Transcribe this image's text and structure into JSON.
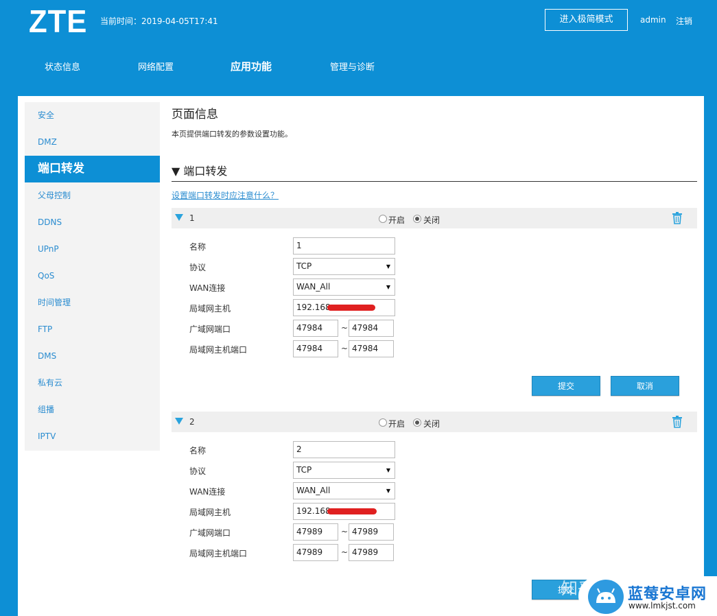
{
  "header": {
    "logo": "ZTE",
    "time_label": "当前时间：2019-04-05T17:41",
    "simple_mode_button": "进入极简模式",
    "user": "admin",
    "logout": "注销"
  },
  "nav": [
    "状态信息",
    "网络配置",
    "应用功能",
    "管理与诊断"
  ],
  "nav_active": "应用功能",
  "sidebar": {
    "items": [
      "安全",
      "DMZ",
      "端口转发",
      "父母控制",
      "DDNS",
      "UPnP",
      "QoS",
      "时间管理",
      "FTP",
      "DMS",
      "私有云",
      "组播",
      "IPTV"
    ],
    "active": "端口转发"
  },
  "content": {
    "page_title": "页面信息",
    "page_desc": "本页提供端口转发的参数设置功能。",
    "section_title": "▼  端口转发",
    "help_link": "设置端口转发时应注意什么？"
  },
  "labels": {
    "enable": "开启",
    "disable": "关闭",
    "name": "名称",
    "protocol": "协议",
    "wan": "WAN连接",
    "lan_host": "局域网主机",
    "wan_port": "广域网端口",
    "lan_port": "局域网主机端口",
    "tilde": "~",
    "submit": "提交",
    "cancel": "取消"
  },
  "rules": [
    {
      "num": "1",
      "state": "关闭",
      "name": "1",
      "protocol": "TCP",
      "wan": "WAN_All",
      "lan_host": "192.168.",
      "wan_port_start": "47984",
      "wan_port_end": "47984",
      "lan_port_start": "47984",
      "lan_port_end": "47984"
    },
    {
      "num": "2",
      "state": "关闭",
      "name": "2",
      "protocol": "TCP",
      "wan": "WAN_All",
      "lan_host": "192.168.",
      "wan_port_start": "47989",
      "wan_port_end": "47989",
      "lan_port_start": "47989",
      "lan_port_end": "47989"
    }
  ],
  "watermark": {
    "zhihu": "知乎",
    "site_name": "蓝莓安卓网",
    "site_url": "www.lmkjst.com"
  },
  "colors": {
    "brand_blue": "#0d8fd5",
    "button_blue": "#2aa0dc",
    "link_blue": "#2a8cd0",
    "redaction": "#e02020"
  }
}
